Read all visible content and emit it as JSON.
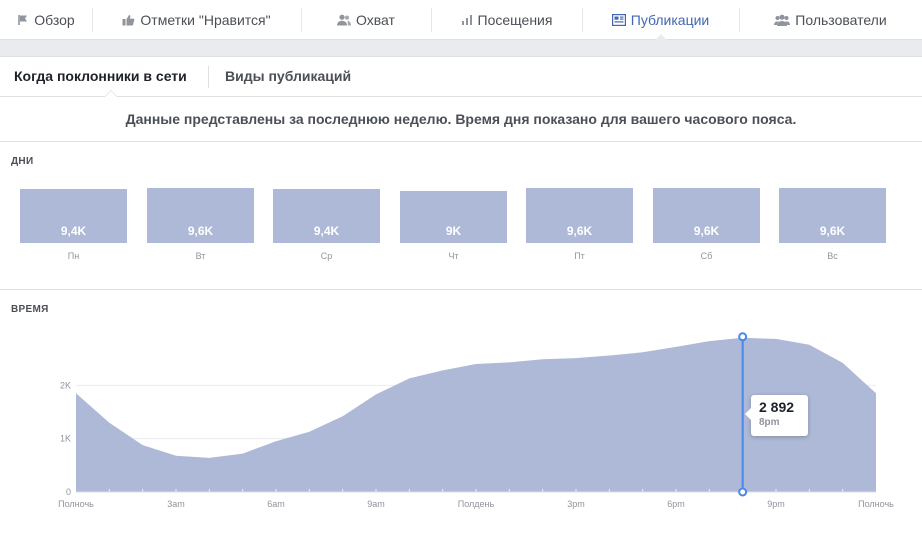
{
  "top_tabs": [
    {
      "label": "Обзор",
      "icon": "flag-icon"
    },
    {
      "label": "Отметки \"Нравится\"",
      "icon": "thumbs-up-icon"
    },
    {
      "label": "Охват",
      "icon": "people-icon"
    },
    {
      "label": "Посещения",
      "icon": "bar-chart-icon"
    },
    {
      "label": "Публикации",
      "icon": "newspaper-icon",
      "active": true
    },
    {
      "label": "Пользователи",
      "icon": "group-icon"
    }
  ],
  "sub_tabs": [
    {
      "label": "Когда поклонники в сети",
      "active": true
    },
    {
      "label": "Виды публикаций"
    }
  ],
  "notice": "Данные представлены за последнюю неделю. Время дня показано для вашего часового пояса.",
  "days_section": {
    "title": "ДНИ",
    "days": [
      {
        "label": "Пн",
        "value_label": "9,4K",
        "value": 9400
      },
      {
        "label": "Вт",
        "value_label": "9,6K",
        "value": 9600
      },
      {
        "label": "Ср",
        "value_label": "9,4K",
        "value": 9400
      },
      {
        "label": "Чт",
        "value_label": "9K",
        "value": 9000
      },
      {
        "label": "Пт",
        "value_label": "9,6K",
        "value": 9600
      },
      {
        "label": "Сб",
        "value_label": "9,6K",
        "value": 9600
      },
      {
        "label": "Вс",
        "value_label": "9,6K",
        "value": 9600
      }
    ]
  },
  "time_section": {
    "title": "ВРЕМЯ",
    "tooltip": {
      "value": "2 892",
      "time": "8pm"
    }
  },
  "colors": {
    "bar": "#adb9d6",
    "accent": "#4267b2",
    "marker": "#4a86e8"
  },
  "chart_data": {
    "type": "area",
    "x": [
      0,
      1,
      2,
      3,
      4,
      5,
      6,
      7,
      8,
      9,
      10,
      11,
      12,
      13,
      14,
      15,
      16,
      17,
      18,
      19,
      20,
      21,
      22,
      23,
      24
    ],
    "x_tick_labels": [
      "Полночь",
      "3am",
      "6am",
      "9am",
      "Полдень",
      "3pm",
      "6pm",
      "9pm",
      "Полночь"
    ],
    "x_tick_positions": [
      0,
      3,
      6,
      9,
      12,
      15,
      18,
      21,
      24
    ],
    "y_tick_labels": [
      "0",
      "1K",
      "2K"
    ],
    "y_tick_values": [
      0,
      1000,
      2000
    ],
    "values": [
      1850,
      1300,
      880,
      680,
      640,
      720,
      950,
      1130,
      1420,
      1830,
      2130,
      2280,
      2400,
      2430,
      2490,
      2510,
      2560,
      2620,
      2720,
      2830,
      2892,
      2870,
      2760,
      2420,
      1850
    ],
    "ylim": [
      0,
      3000
    ],
    "xlim": [
      0,
      24
    ],
    "highlight": {
      "x": 20,
      "value": 2892
    }
  }
}
